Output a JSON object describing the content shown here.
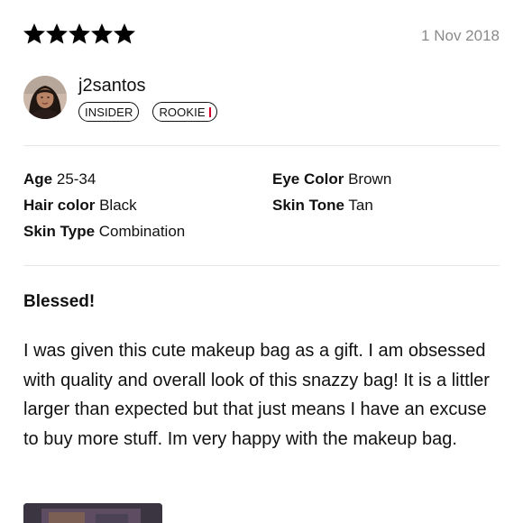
{
  "review": {
    "rating": 5,
    "rating_max": 5,
    "date": "1 Nov 2018",
    "author": {
      "username": "j2santos",
      "badges": [
        "INSIDER",
        "ROOKIE"
      ]
    },
    "attributes": {
      "age": {
        "key": "Age",
        "value": "25-34"
      },
      "hair_color": {
        "key": "Hair color",
        "value": "Black"
      },
      "skin_type": {
        "key": "Skin Type",
        "value": "Combination"
      },
      "eye_color": {
        "key": "Eye Color",
        "value": "Brown"
      },
      "skin_tone": {
        "key": "Skin Tone",
        "value": "Tan"
      }
    },
    "title": "Blessed!",
    "body": "I was given this cute makeup bag as a gift. I am obsessed with quality and overall look of this snazzy bag! It is a littler larger than expected but that just means I have an excuse to buy more stuff. Im very happy with the makeup bag."
  },
  "colors": {
    "text": "#111111",
    "date": "#8a8a8a",
    "divider": "#e6e6e6",
    "rookie_accent": "#d3002c"
  },
  "icons": {
    "star": "star-icon"
  }
}
